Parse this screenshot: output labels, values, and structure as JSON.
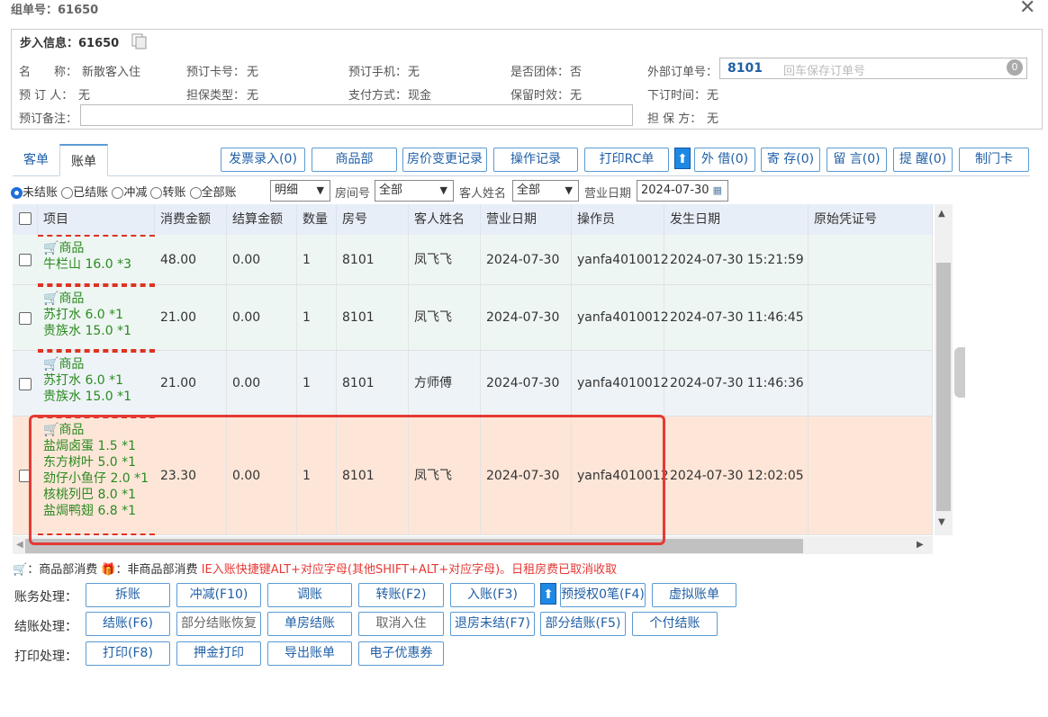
{
  "window": {
    "title": "组单号：61650",
    "close": "✕"
  },
  "info": {
    "title": "步入信息：61650",
    "fields": [
      {
        "label": "名　　称：",
        "value": "新散客入住"
      },
      {
        "label": "预订卡号：",
        "value": "无"
      },
      {
        "label": "预订手机：",
        "value": "无"
      },
      {
        "label": "是否团体：",
        "value": "否"
      },
      {
        "label": "外部订单号：",
        "value": ""
      },
      {
        "label": "预 订 人：",
        "value": "无"
      },
      {
        "label": "担保类型：",
        "value": "无"
      },
      {
        "label": "支付方式：",
        "value": "现金"
      },
      {
        "label": "保留时效：",
        "value": "无"
      },
      {
        "label": "下订时间：",
        "value": "无"
      },
      {
        "label": "预订备注：",
        "value": ""
      },
      {
        "label": "担 保 方：",
        "value": "无"
      }
    ],
    "external_order_value": "8101",
    "external_order_placeholder": "回车保存订单号"
  },
  "tabs": [
    "客单",
    "账单"
  ],
  "toolbar": [
    "发票录入(0)",
    "商品部",
    "房价变更记录",
    "操作记录",
    "打印RC单",
    "外 借(0)",
    "寄 存(0)",
    "留 言(0)",
    "提 醒(0)",
    "制门卡"
  ],
  "filters": {
    "radios": [
      "未结账",
      "已结账",
      "冲减",
      "转账",
      "全部账"
    ],
    "detail_select": "明细",
    "room_label": "房间号",
    "room_select": "全部",
    "guest_label": "客人姓名",
    "guest_select": "全部",
    "date_label": "营业日期",
    "date_value": "2024-07-30"
  },
  "table": {
    "headers": [
      "项目",
      "消费金额",
      "结算金额",
      "数量",
      "房号",
      "客人姓名",
      "营业日期",
      "操作员",
      "发生日期",
      "原始凭证号"
    ],
    "rows": [
      {
        "category": "商品",
        "items": [
          "牛栏山 16.0 *3"
        ],
        "amount": "48.00",
        "settle": "0.00",
        "qty": "1",
        "room": "8101",
        "guest": "凤飞飞",
        "bizdate": "2024-07-30",
        "operator": "yanfa4010012",
        "time": "2024-07-30 15:21:59",
        "voucher": ""
      },
      {
        "category": "商品",
        "items": [
          "苏打水 6.0 *1",
          "贵族水 15.0 *1"
        ],
        "amount": "21.00",
        "settle": "0.00",
        "qty": "1",
        "room": "8101",
        "guest": "凤飞飞",
        "bizdate": "2024-07-30",
        "operator": "yanfa4010012",
        "time": "2024-07-30 11:46:45",
        "voucher": ""
      },
      {
        "category": "商品",
        "items": [
          "苏打水 6.0 *1",
          "贵族水 15.0 *1"
        ],
        "amount": "21.00",
        "settle": "0.00",
        "qty": "1",
        "room": "8101",
        "guest": "方师傅",
        "bizdate": "2024-07-30",
        "operator": "yanfa4010012",
        "time": "2024-07-30 11:46:36",
        "voucher": ""
      },
      {
        "category": "商品",
        "items": [
          "盐焗卤蛋 1.5 *1",
          "东方树叶 5.0 *1",
          "劲仔小鱼仔 2.0 *1",
          "核桃列巴 8.0 *1",
          "盐焗鸭翅 6.8 *1"
        ],
        "amount": "23.30",
        "settle": "0.00",
        "qty": "1",
        "room": "8101",
        "guest": "凤飞飞",
        "bizdate": "2024-07-30",
        "operator": "yanfa4010012",
        "time": "2024-07-30 12:02:05",
        "voucher": ""
      }
    ]
  },
  "legend": {
    "goods": "：商品部消费",
    "nongoods": "：非商品部消费",
    "hint": "IE入账快捷键ALT+对应字母(其他SHIFT+ALT+对应字母)。日租房费已取消收取"
  },
  "actions": {
    "billing_label": "账务处理：",
    "billing": [
      "拆账",
      "冲减(F10)",
      "调账",
      "转账(F2)",
      "入账(F3)",
      "预授权0笔(F4)",
      "虚拟账单"
    ],
    "checkout_label": "结账处理：",
    "checkout": [
      "结账(F6)",
      "部分结账恢复",
      "单房结账",
      "取消入住",
      "退房未结(F7)",
      "部分结账(F5)",
      "个付结账"
    ],
    "print_label": "打印处理：",
    "print": [
      "打印(F8)",
      "押金打印",
      "导出账单",
      "电子优惠券"
    ]
  },
  "colors": {
    "accent": "#1f5fa7",
    "highlight_row": "#fde6d8",
    "row_alt": "#eef6f3",
    "goods_text": "#2a8a1f",
    "alert": "#e53935"
  }
}
